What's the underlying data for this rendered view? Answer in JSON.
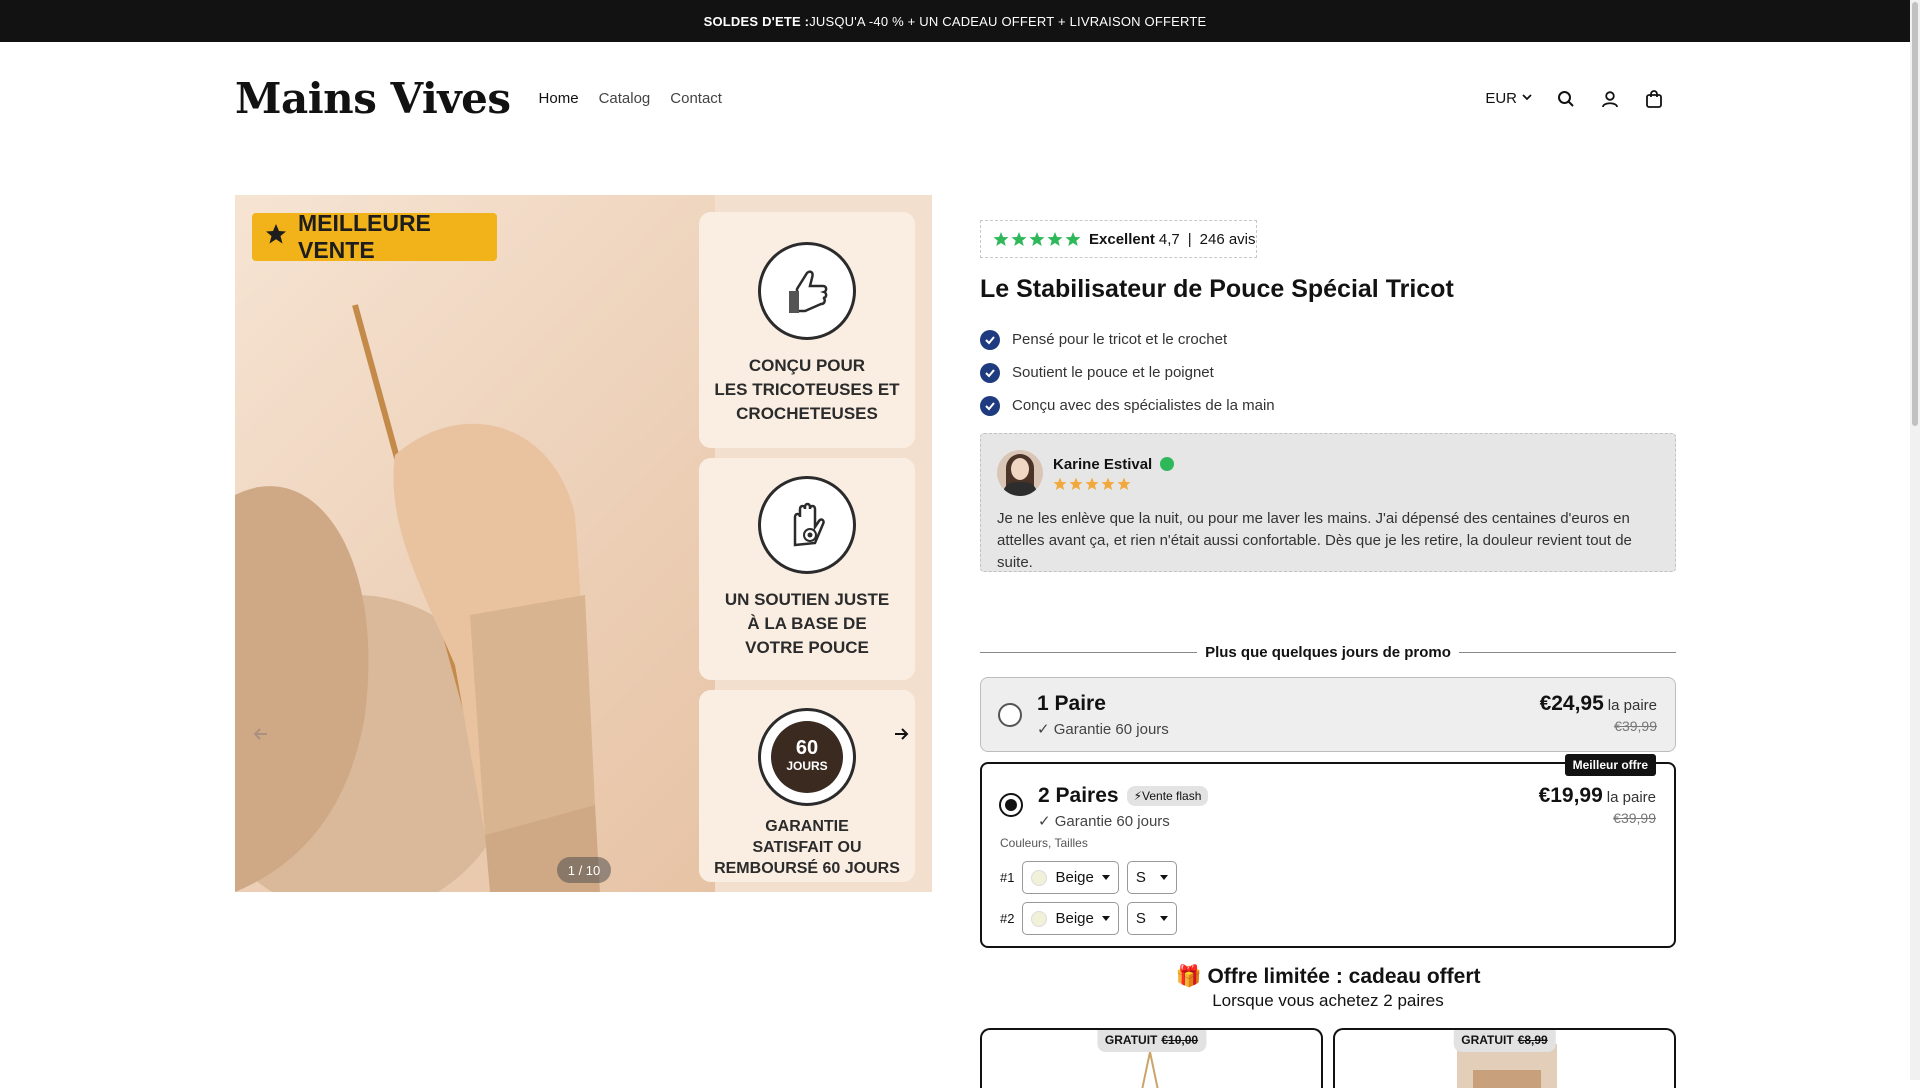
{
  "announcement": {
    "bold": "SOLDES D'ETE :",
    "text": " JUSQU'A -40 % + UN CADEAU OFFERT + LIVRAISON OFFERTE"
  },
  "header": {
    "logo": "Mains Vives",
    "nav": [
      "Home",
      "Catalog",
      "Contact"
    ],
    "currency": "EUR"
  },
  "gallery": {
    "badge": "MEILLEURE VENTE",
    "features": [
      {
        "line1": "CONÇU POUR",
        "line2": "LES TRICOTEUSES ET",
        "line3": "CROCHETEUSES",
        "icon": "thumb-hand-icon"
      },
      {
        "line1": "UN SOUTIEN JUSTE",
        "line2": "À LA BASE DE",
        "line3": "VOTRE POUCE",
        "icon": "palm-target-icon"
      },
      {
        "line1": "GARANTIE",
        "line2": "SATISFAIT OU",
        "line3": "REMBOURSÉ 60 JOURS",
        "icon": "badge-60-icon",
        "badge_top": "60",
        "badge_bottom": "JOURS"
      }
    ],
    "counter": "1 / 10"
  },
  "product": {
    "rating_label": "Excellent",
    "rating_value": "4,7",
    "rating_sep": "|",
    "rating_count": "246 avis",
    "title": "Le Stabilisateur de Pouce Spécial Tricot",
    "bullets": [
      "Pensé pour le tricot et le crochet",
      "Soutient le pouce et le poignet",
      "Conçu avec des spécialistes de la main"
    ],
    "review": {
      "name": "Karine Estival",
      "rating": 5,
      "text": "Je ne les enlève que la nuit, ou pour me laver les mains. J'ai dépensé des centaines d'euros en attelles avant ça, et rien n'était aussi confortable. Dès que je les retire, la douleur revient tout de suite."
    },
    "promo_label": "Plus que quelques jours de promo",
    "offers": [
      {
        "title": "1 Paire",
        "subtitle": "✓ Garantie 60 jours",
        "price": "€24,95",
        "per": "la paire",
        "compare": "€39,99",
        "selected": false
      },
      {
        "title": "2 Paires",
        "tag": "⚡Vente flash",
        "subtitle": "✓ Garantie 60 jours",
        "price": "€19,99",
        "per": "la paire",
        "compare": "€39,99",
        "best": "Meilleur offre",
        "selected": true,
        "options_label": "Couleurs, Tailles",
        "rows": [
          {
            "index": "#1",
            "color": "Beige",
            "size": "S"
          },
          {
            "index": "#2",
            "color": "Beige",
            "size": "S"
          }
        ]
      }
    ],
    "gift": {
      "title": "🎁 Offre limitée : cadeau offert",
      "subtitle": "Lorsque vous achetez 2 paires",
      "cards": [
        {
          "free": "GRATUIT",
          "compare": "€10,00"
        },
        {
          "free": "GRATUIT",
          "compare": "€8,99"
        }
      ]
    }
  },
  "colors": {
    "star_green": "#2fb85a",
    "star_orange": "#f2a93b",
    "check_blue": "#1f3b80",
    "badge_yellow": "#f2b21a"
  }
}
